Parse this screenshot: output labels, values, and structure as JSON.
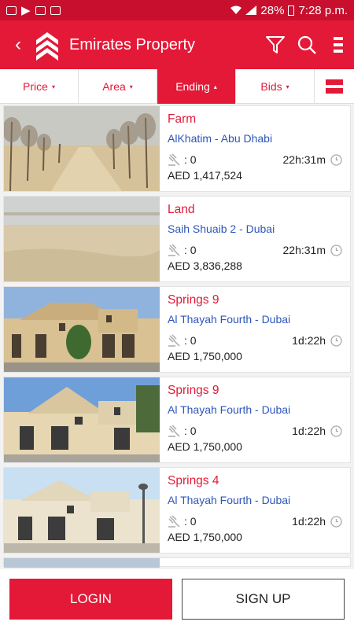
{
  "status_bar": {
    "battery": "28%",
    "time": "7:28 p.m."
  },
  "header": {
    "back": "‹",
    "title": "Emirates Property",
    "icons": [
      "filter-icon",
      "search-icon",
      "menu-icon"
    ]
  },
  "sort": {
    "tabs": [
      {
        "label": "Price",
        "caret": "▾",
        "active": false
      },
      {
        "label": "Area",
        "caret": "▾",
        "active": false
      },
      {
        "label": "Ending",
        "caret": "▴",
        "active": true
      },
      {
        "label": "Bids",
        "caret": "▾",
        "active": false
      }
    ]
  },
  "listings": [
    {
      "title": "Farm",
      "location": "AlKhatim - Abu Dhabi",
      "bids": ": 0",
      "time_left": "22h:31m",
      "price": "AED 1,417,524"
    },
    {
      "title": "Land",
      "location": "Saih Shuaib 2 - Dubai",
      "bids": ": 0",
      "time_left": "22h:31m",
      "price": "AED 3,836,288"
    },
    {
      "title": "Springs 9",
      "location": "Al Thayah Fourth - Dubai",
      "bids": ": 0",
      "time_left": "1d:22h",
      "price": "AED 1,750,000"
    },
    {
      "title": "Springs 9",
      "location": "Al Thayah Fourth - Dubai",
      "bids": ": 0",
      "time_left": "1d:22h",
      "price": "AED 1,750,000"
    },
    {
      "title": "Springs 4",
      "location": "Al Thayah Fourth - Dubai",
      "bids": ": 0",
      "time_left": "1d:22h",
      "price": "AED 1,750,000"
    }
  ],
  "buttons": {
    "login": "LOGIN",
    "signup": "SIGN UP"
  },
  "colors": {
    "brand": "#e31937",
    "link": "#2e56b8"
  }
}
